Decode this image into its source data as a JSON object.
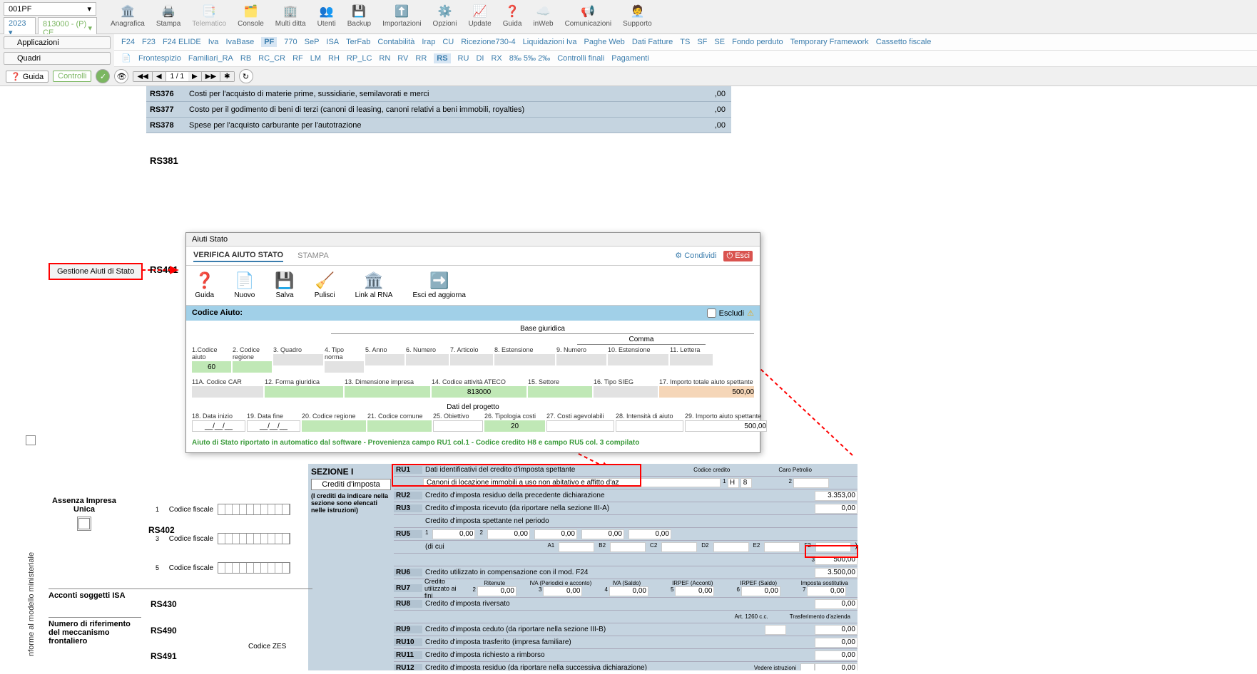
{
  "topLeft": {
    "sel1": "001PF",
    "year": "2023",
    "sel2": "813000 - (P) CE"
  },
  "toolbar": [
    {
      "label": "Anagrafica",
      "icon": "🏛️"
    },
    {
      "label": "Stampa",
      "icon": "🖨️"
    },
    {
      "label": "Telematico",
      "icon": "📑",
      "disabled": true
    },
    {
      "label": "Console",
      "icon": "🗂️"
    },
    {
      "label": "Multi ditta",
      "icon": "🏢"
    },
    {
      "label": "Utenti",
      "icon": "👥"
    },
    {
      "label": "Backup",
      "icon": "💾"
    },
    {
      "label": "Importazioni",
      "icon": "⬆️"
    },
    {
      "label": "Opzioni",
      "icon": "⚙️"
    },
    {
      "label": "Update",
      "icon": "📈"
    },
    {
      "label": "Guida",
      "icon": "❓"
    },
    {
      "label": "inWeb",
      "icon": "☁️"
    },
    {
      "label": "Comunicazioni",
      "icon": "📢"
    },
    {
      "label": "Supporto",
      "icon": "🧑‍💼"
    }
  ],
  "btnRow": {
    "applicazioni": "Applicazioni",
    "quadri": "Quadri"
  },
  "tabs1": [
    "F24",
    "F23",
    "F24 ELIDE",
    "Iva",
    "IvaBase",
    "PF",
    "770",
    "SeP",
    "ISA",
    "TerFab",
    "Contabilità",
    "Irap",
    "CU",
    "Ricezione730-4",
    "Liquidazioni Iva",
    "Paghe Web",
    "Dati Fatture",
    "TS",
    "SF",
    "SE",
    "Fondo perduto",
    "Temporary Framework",
    "Cassetto fiscale"
  ],
  "tabs1_active": "PF",
  "tabs2": [
    "Frontespizio",
    "Familiari_RA",
    "RB",
    "RC_CR",
    "RF",
    "LM",
    "RH",
    "RP_LC",
    "RN",
    "RV",
    "RR",
    "RS",
    "RU",
    "DI",
    "RX",
    "8‰ 5‰ 2‰",
    "Controlli finali",
    "Pagamenti"
  ],
  "tabs2_active": "RS",
  "ctrlBar": {
    "guida": "Guida",
    "controlli": "Controlli",
    "nav": "1 / 1"
  },
  "rsRows": [
    {
      "code": "RS376",
      "desc": "Costi per l'acquisto di materie prime, sussidiarie, semilavorati e merci",
      "val": ",00"
    },
    {
      "code": "RS377",
      "desc": "Costo per il godimento di beni di terzi (canoni di leasing, canoni relativi a beni immobili, royalties)",
      "val": ",00"
    },
    {
      "code": "RS378",
      "desc": "Spese per l'acquisto carburante per l'autotrazione",
      "val": ",00"
    }
  ],
  "rs381": "RS381",
  "rs401": "RS401",
  "gestione": "Gestione Aiuti di Stato",
  "modal": {
    "title": "Aiuti Stato",
    "tab1": "VERIFICA AIUTO STATO",
    "tab2": "STAMPA",
    "share": "Condividi",
    "esci": "Esci",
    "toolbar": [
      {
        "label": "Guida",
        "icon": "❓"
      },
      {
        "label": "Nuovo",
        "icon": "📄"
      },
      {
        "label": "Salva",
        "icon": "💾"
      },
      {
        "label": "Pulisci",
        "icon": "🧹"
      },
      {
        "label": "Link al RNA",
        "icon": "🏛️"
      },
      {
        "label": "Esci ed aggiorna",
        "icon": "➡️"
      }
    ],
    "codiceAiuto": "Codice Aiuto:",
    "escludi": "Escludi",
    "baseGiuridica": "Base giuridica",
    "comma": "Comma",
    "datiProgetto": "Dati del progetto",
    "row1Labels": [
      "1.Codice aiuto",
      "2. Codice regione",
      "3. Quadro",
      "4. Tipo norma",
      "5. Anno",
      "6. Numero",
      "7. Articolo",
      "8. Estensione",
      "9. Numero",
      "10. Estensione",
      "11. Lettera"
    ],
    "row1Vals": {
      "codiceAiuto": "60"
    },
    "row2Labels": [
      "11A. Codice CAR",
      "12. Forma giuridica",
      "13. Dimensione impresa",
      "14. Codice attività ATECO",
      "15. Settore",
      "16. Tipo SIEG",
      "17. Importo totale aiuto spettante"
    ],
    "row2Vals": {
      "ateco": "813000",
      "importo": "500,00"
    },
    "row3Labels": [
      "18. Data inizio",
      "19. Data fine",
      "20. Codice regione",
      "21. Codice comune",
      "25. Obiettivo",
      "26. Tipologia costi",
      "27. Costi agevolabili",
      "28. Intensità di aiuto",
      "29. Importo aiuto spettante"
    ],
    "row3Vals": {
      "dataInizio": "__/__/__",
      "dataFine": "__/__/__",
      "tipologia": "20",
      "importo": "500,00"
    },
    "autoNote": "Aiuto di Stato riportato in automatico dal software - Provenienza campo RU1 col.1 - Codice credito H8 e campo RU5 col. 3 compilato"
  },
  "sezione": {
    "title": "SEZIONE I",
    "sub": "Crediti d'imposta",
    "note": "(I crediti da indicare nella sezione sono elencati nelle istruzioni)"
  },
  "ruRows": {
    "ru1": {
      "code": "RU1",
      "desc": "Dati identificativi del credito d'imposta spettante",
      "sub": "Canoni di locazione immobili a uso non abitativo e affitto d'az",
      "credLabel": "Codice credito",
      "h": "H",
      "val8": "8",
      "caroLabel": "Caro Petrolio",
      "caroN": "2"
    },
    "ru2": {
      "code": "RU2",
      "desc": "Credito d'imposta residuo della precedente dichiarazione",
      "val": "3.353,00"
    },
    "ru3": {
      "code": "RU3",
      "desc": "Credito d'imposta ricevuto (da riportare nella sezione III-A)",
      "val": "0,00"
    },
    "ru5top": {
      "desc": "Credito d'imposta spettante nel periodo"
    },
    "ru5": {
      "code": "RU5",
      "dicui": "(di cui",
      "b2": "0,00",
      "c2": "0,00",
      "d2": "0,00",
      "e2": "0,00",
      "f2": "0,00",
      "a": "A1",
      "b": "B2",
      "c": "C2",
      "d": "D2",
      "e": "E2",
      "f": "F2",
      "g": ")",
      "main": "500,00",
      "mainN": "3"
    },
    "ru6": {
      "code": "RU6",
      "desc": "Credito utilizzato in compensazione con il mod. F24",
      "val": "3.500,00"
    },
    "ru7": {
      "code": "RU7",
      "desc": "Credito utilizzato ai fini",
      "labs": [
        "Ritenute",
        "IVA (Periodici e acconto)",
        "IVA (Saldo)",
        "IRPEF (Acconti)",
        "IRPEF (Saldo)",
        "Imposta sostitutiva"
      ],
      "vals": [
        "0,00",
        "0,00",
        "0,00",
        "0,00",
        "0,00",
        "0,00"
      ],
      "nums": [
        "2",
        "3",
        "4",
        "5",
        "6",
        "7"
      ]
    },
    "ru8": {
      "code": "RU8",
      "desc": "Credito d'imposta riversato",
      "val": "0,00"
    },
    "ru8b": {
      "art": "Art. 1260 c.c.",
      "trasf": "Trasferimento d'azienda"
    },
    "ru9": {
      "code": "RU9",
      "desc": "Credito d'imposta ceduto (da riportare nella sezione III-B)",
      "val": "0,00"
    },
    "ru10": {
      "code": "RU10",
      "desc": "Credito d'imposta trasferito (impresa familiare)",
      "val": "0,00"
    },
    "ru11": {
      "code": "RU11",
      "desc": "Credito d'imposta richiesto a rimborso",
      "val": "0,00"
    },
    "ru12": {
      "code": "RU12",
      "desc": "Credito d'imposta residuo (da riportare nella successiva dichiarazione)",
      "vedere": "Vedere istruzioni",
      "val": "0,00"
    }
  },
  "rs402": {
    "assenza": "Assenza Impresa Unica",
    "codFisc": "Codice fiscale",
    "n1": "1",
    "n3": "3",
    "n5": "5",
    "code": "RS402"
  },
  "bottomRows": {
    "acconti": "Acconti soggetti ISA",
    "rs430": "RS430",
    "numero": "Numero di riferimento del meccanismo frontaliero",
    "rs490": "RS490",
    "zes": "Codice ZES",
    "rs491": "RS491"
  },
  "sideText": "nforme al modello ministeriale"
}
